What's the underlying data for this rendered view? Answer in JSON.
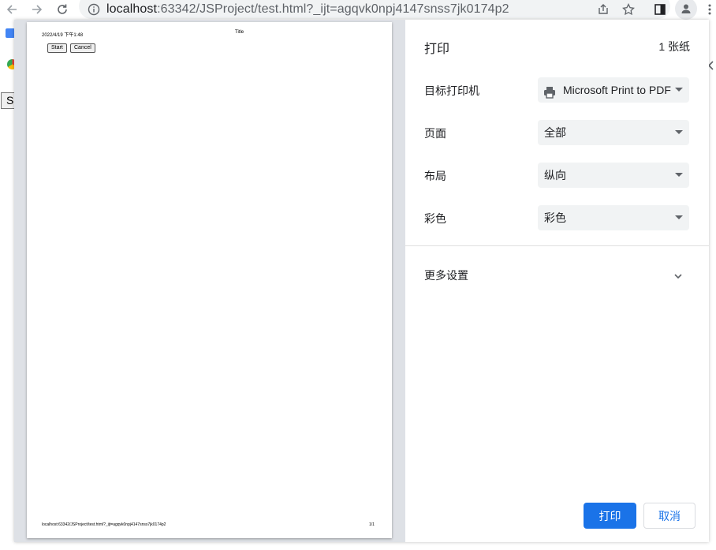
{
  "browser": {
    "url_host": "localhost",
    "url_rest": ":63342/JSProject/test.html?_ijt=agqvk0npj4147snss7jk0174p2"
  },
  "underlying_page": {
    "button_fragment": "S"
  },
  "preview": {
    "header_date": "2022/4/19 下午1:48",
    "header_title": "Title",
    "buttons": [
      "Start",
      "Cancel"
    ],
    "footer_url": "localhost:63342/JSProject/test.html?_ijt=agqvk0npj4147snss7jk0174p2",
    "footer_page": "1/1"
  },
  "print": {
    "title": "打印",
    "sheet_count": "1 张纸",
    "rows": [
      {
        "label": "目标打印机",
        "value": "Microsoft Print to PDF"
      },
      {
        "label": "页面",
        "value": "全部"
      },
      {
        "label": "布局",
        "value": "纵向"
      },
      {
        "label": "彩色",
        "value": "彩色"
      }
    ],
    "more_settings": "更多设置",
    "print_button": "打印",
    "cancel_button": "取消"
  },
  "colors": {
    "accent": "#1a73e8",
    "preview_bg": "#dee1e6",
    "select_bg": "#f1f3f4"
  }
}
